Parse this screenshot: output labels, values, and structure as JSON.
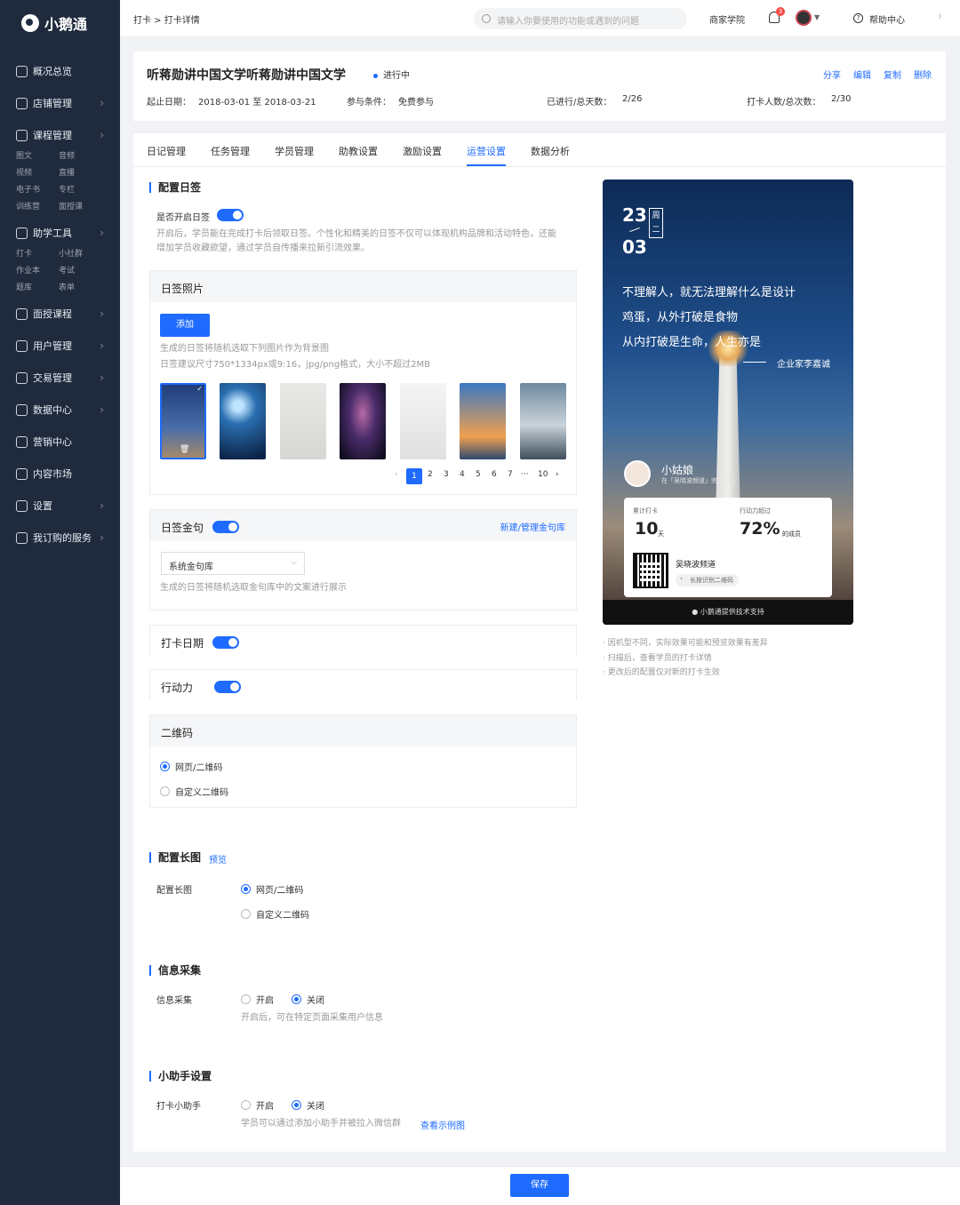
{
  "app": {
    "logo": "小鹅通"
  },
  "sidebar": {
    "items": [
      {
        "label": "概况总览",
        "arrow": false
      },
      {
        "label": "店铺管理",
        "arrow": true
      },
      {
        "label": "课程管理",
        "arrow": true,
        "sub": [
          "图文",
          "音频",
          "视频",
          "直播",
          "电子书",
          "专栏",
          "训练营",
          "面授课"
        ]
      },
      {
        "label": "助学工具",
        "arrow": true,
        "sub": [
          "打卡",
          "小社群",
          "作业本",
          "考试",
          "题库",
          "表单"
        ]
      },
      {
        "label": "面授课程",
        "arrow": true
      },
      {
        "label": "用户管理",
        "arrow": true
      },
      {
        "label": "交易管理",
        "arrow": true
      },
      {
        "label": "数据中心",
        "arrow": true
      },
      {
        "label": "营销中心",
        "arrow": false
      },
      {
        "label": "内容市场",
        "arrow": false
      },
      {
        "label": "设置",
        "arrow": true
      },
      {
        "label": "我订购的服务",
        "arrow": true
      }
    ]
  },
  "topbar": {
    "breadcrumb": "打卡 > 打卡详情",
    "search_placeholder": "请输入你要使用的功能或遇到的问题",
    "merchant_academy": "商家学院",
    "notification_count": "3",
    "help_center": "帮助中心"
  },
  "header": {
    "title": "听蒋勋讲中国文学听蒋勋讲中国文学",
    "status": "进行中",
    "actions": [
      "分享",
      "编辑",
      "复制",
      "删除"
    ],
    "date_label": "起止日期：",
    "date_value": "2018-03-01 至 2018-03-21",
    "cond_label": "参与条件：",
    "cond_value": "免费参与",
    "progress_label": "已进行/总天数：",
    "progress_value": "2/26",
    "count_label": "打卡人数/总次数：",
    "count_value": "2/30"
  },
  "tabs": [
    "日记管理",
    "任务管理",
    "学员管理",
    "助教设置",
    "激励设置",
    "运营设置",
    "数据分析"
  ],
  "active_tab": "运营设置",
  "config_card": {
    "title": "配置日签",
    "enable_label": "是否开启日签",
    "enable_desc_1": "开启后，学员能在完成打卡后领取日签。个性化和精美的日签不仅可以体现机构品牌和活动特色，还能",
    "enable_desc_2": "增加学员收藏欲望，通过学员自传播来拉新引流效果。",
    "photo_panel": {
      "title": "日签照片",
      "add_button": "添加",
      "desc_1": "生成的日签将随机选取下列图片作为背景图",
      "desc_2": "日签建议尺寸750*1334px或9:16，jpg/png格式，大小不超过2MB",
      "pages": [
        "1",
        "2",
        "3",
        "4",
        "5",
        "6",
        "7",
        "···",
        "10"
      ]
    },
    "quote_panel": {
      "title": "日签金句",
      "manage_link": "新建/管理金句库",
      "select_value": "系统金句库",
      "desc": "生成的日签将随机选取金句库中的文案进行展示"
    },
    "date_panel": {
      "title": "打卡日期"
    },
    "action_panel": {
      "title": "行动力"
    },
    "qr_panel": {
      "title": "二维码",
      "options": [
        "网页/二维码",
        "自定义二维码"
      ],
      "selected": 0
    }
  },
  "long_image": {
    "title": "配置长图",
    "preview_link": "预览",
    "label": "配置长图",
    "options": [
      "网页/二维码",
      "自定义二维码"
    ]
  },
  "info_collect": {
    "title": "信息采集",
    "label": "信息采集",
    "options": [
      "开启",
      "关闭"
    ],
    "desc": "开启后，可在特定页面采集用户信息"
  },
  "assistant": {
    "title": "小助手设置",
    "label": "打卡小助手",
    "options": [
      "开启",
      "关闭"
    ],
    "desc": "学员可以通过添加小助手并被拉入微信群",
    "example_link": "查看示例图"
  },
  "preview": {
    "day": "23",
    "month": "03",
    "weekday": "周二",
    "quote_lines": [
      "不理解人，就无法理解什么是设计",
      "鸡蛋，从外打破是食物",
      "从内打破是生命，人生亦是"
    ],
    "author": "企业家李嘉诚",
    "user_name": "小姑娘",
    "user_sub": "在「吴晓波频道」完成打卡",
    "stat1_label": "累计打卡",
    "stat1_value": "10",
    "stat1_unit": "天",
    "stat2_label": "行动力超过",
    "stat2_value": "72%",
    "stat2_unit": "的成员",
    "channel": "吴晓波频道",
    "qr_hint": "长按识别二维码",
    "tech": "小鹅通提供技术支持"
  },
  "preview_notes": [
    "· 因机型不同，实际效果可能和预览效果有差异",
    "· 扫描后，查看学员的打卡详情",
    "· 更改后的配置仅对新的打卡生效"
  ],
  "footer": {
    "save": "保存"
  },
  "colors": {
    "accent": "#1f6bff",
    "sidebar": "#1f2a3d"
  }
}
